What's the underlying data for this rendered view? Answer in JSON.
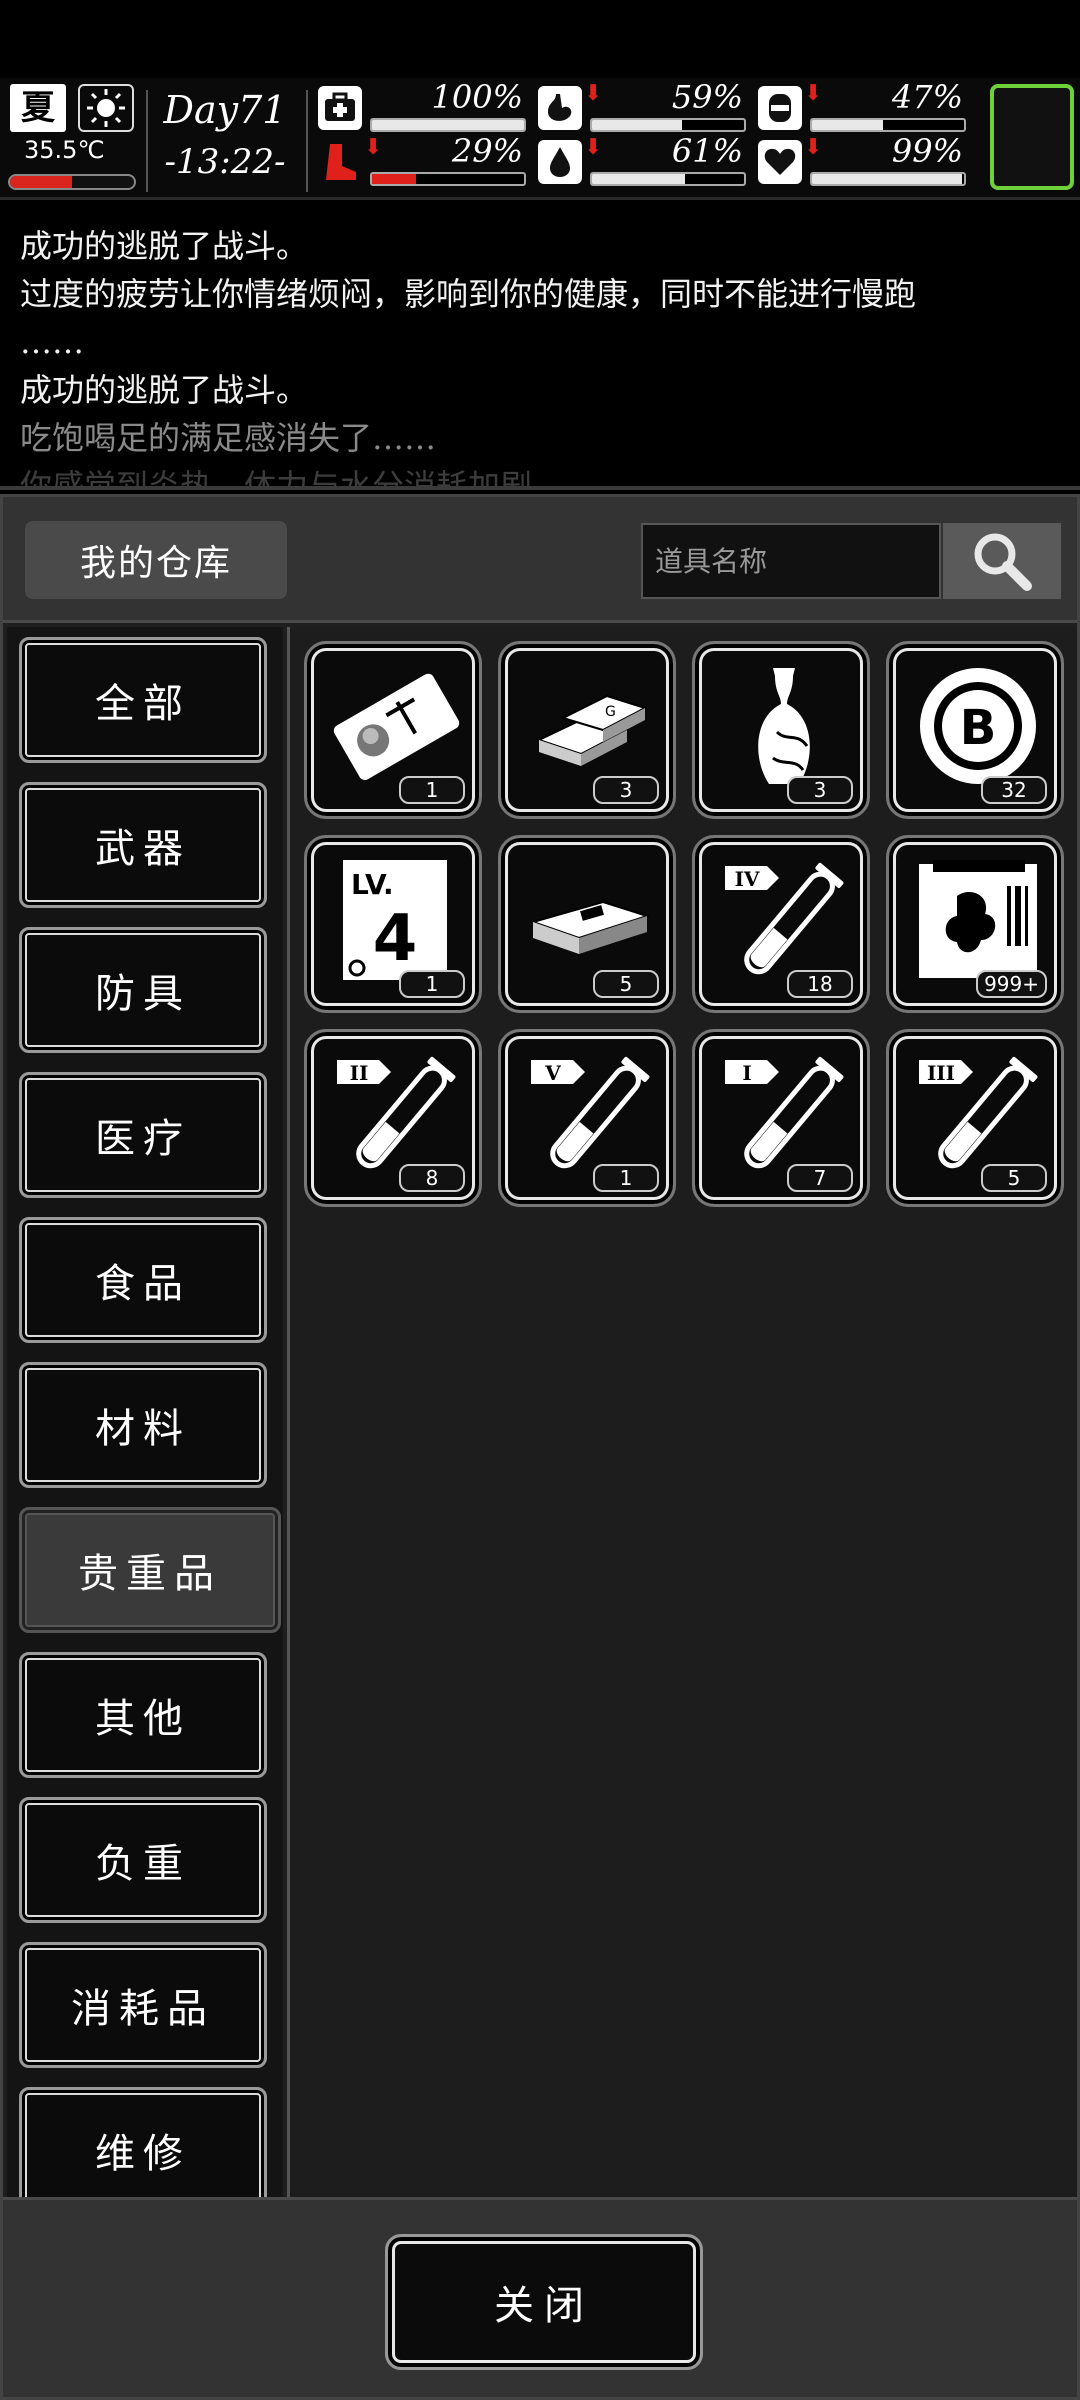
{
  "status": {
    "season": "夏",
    "temperature": "35.5℃",
    "temperature_level": 0.5,
    "day": "Day71",
    "time": "-13:22-",
    "stats": [
      {
        "name": "health",
        "value": "100%",
        "level": 1.0,
        "warning": false,
        "icon": "medkit-icon"
      },
      {
        "name": "hunger",
        "value": "59%",
        "level": 0.59,
        "warning": true,
        "icon": "stomach-icon"
      },
      {
        "name": "pain",
        "value": "47%",
        "level": 0.47,
        "warning": true,
        "icon": "bandage-icon"
      },
      {
        "name": "stamina",
        "value": "29%",
        "level": 0.29,
        "warning": true,
        "icon": "boot-icon"
      },
      {
        "name": "thirst",
        "value": "61%",
        "level": 0.61,
        "warning": true,
        "icon": "water-drop-icon"
      },
      {
        "name": "mood",
        "value": "99%",
        "level": 0.99,
        "warning": true,
        "icon": "heart-icon"
      }
    ]
  },
  "log": [
    "成功的逃脱了战斗。",
    "过度的疲劳让你情绪烦闷，影响到你的健康，同时不能进行慢跑",
    "……",
    "成功的逃脱了战斗。",
    "吃饱喝足的满足感消失了……",
    "你感觉到炎热，体力与水分消耗加剧……"
  ],
  "panel": {
    "title": "我的仓库",
    "search_placeholder": "道具名称"
  },
  "categories": [
    "全部",
    "武器",
    "防具",
    "医疗",
    "食品",
    "材料",
    "贵重品",
    "其他",
    "负重",
    "消耗品",
    "维修"
  ],
  "active_category": "贵重品",
  "items": [
    {
      "icon": "ticket-icon",
      "count": "1"
    },
    {
      "icon": "gold-bars-icon",
      "count": "3"
    },
    {
      "icon": "vase-icon",
      "count": "3"
    },
    {
      "icon": "bitcoin-chip-icon",
      "count": "32"
    },
    {
      "icon": "level-card-icon",
      "count": "1"
    },
    {
      "icon": "cash-stack-icon",
      "count": "5"
    },
    {
      "icon": "potion-iv-icon",
      "count": "18"
    },
    {
      "icon": "card-pack-icon",
      "count": "999+"
    },
    {
      "icon": "potion-ii-icon",
      "count": "8"
    },
    {
      "icon": "potion-v-icon",
      "count": "1"
    },
    {
      "icon": "potion-i-icon",
      "count": "7"
    },
    {
      "icon": "potion-iii-icon",
      "count": "5"
    }
  ],
  "labels": {
    "level_card": "LV.",
    "level_number": "4",
    "roman": {
      "potion_iv": "IV",
      "potion_ii": "II",
      "potion_v": "V",
      "potion_i": "I",
      "potion_iii": "III"
    },
    "coin_letter": "B",
    "bar_letter": "G"
  },
  "footer": {
    "close_label": "关闭"
  },
  "colors": {
    "warning": "#e0201a",
    "accent_green": "#6fd13a",
    "temp_fill": "#d9251d"
  }
}
